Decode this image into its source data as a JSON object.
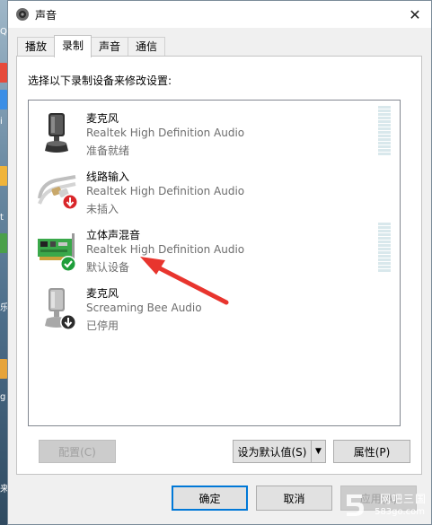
{
  "window": {
    "title": "声音",
    "close_glyph": "✕"
  },
  "tabs": [
    {
      "label": "播放",
      "active": false
    },
    {
      "label": "录制",
      "active": true
    },
    {
      "label": "声音",
      "active": false
    },
    {
      "label": "通信",
      "active": false
    }
  ],
  "panel": {
    "instruction": "选择以下录制设备来修改设置:"
  },
  "devices": [
    {
      "name": "麦克风",
      "driver": "Realtek High Definition Audio",
      "status": "准备就绪",
      "icon": "microphone-icon",
      "badge": "none",
      "meter": true
    },
    {
      "name": "线路输入",
      "driver": "Realtek High Definition Audio",
      "status": "未插入",
      "icon": "line-in-cable-icon",
      "badge": "red-down-arrow",
      "meter": false
    },
    {
      "name": "立体声混音",
      "driver": "Realtek High Definition Audio",
      "status": "默认设备",
      "icon": "sound-card-icon",
      "badge": "green-check",
      "meter": true
    },
    {
      "name": "麦克风",
      "driver": "Screaming Bee Audio",
      "status": "已停用",
      "icon": "microphone-disabled-icon",
      "badge": "black-down-arrow",
      "meter": false
    }
  ],
  "buttons": {
    "configure": "配置(C)",
    "set_default": "设为默认值(S)",
    "properties": "属性(P)",
    "ok": "确定",
    "cancel": "取消",
    "apply": "应用(A)"
  },
  "desktop": {
    "edge_letters": [
      "Q",
      "i",
      "t",
      "乐",
      "g",
      "来"
    ]
  },
  "watermark": {
    "brand": "网吧三国",
    "url": "583go.com"
  },
  "colors": {
    "accent": "#0078d7",
    "annotation_arrow": "#e8352e",
    "check_green": "#1e9e3a",
    "badge_red": "#d9262a"
  }
}
